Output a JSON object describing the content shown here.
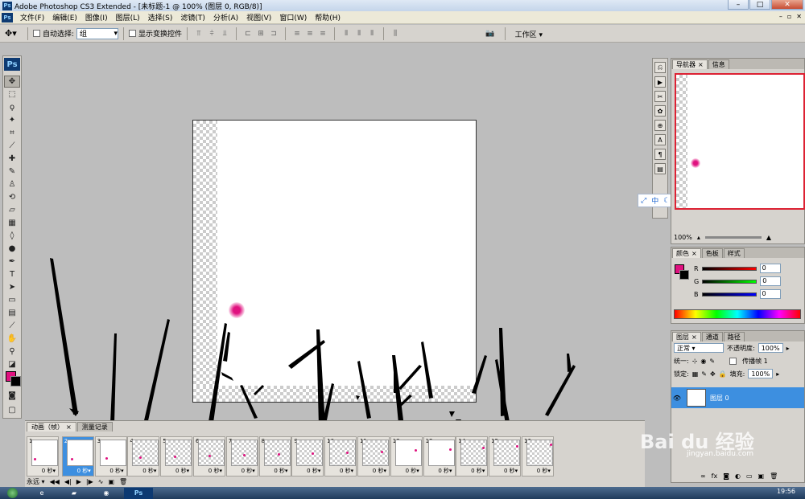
{
  "window": {
    "app_title": "Adobe Photoshop CS3 Extended - [未标题-1 @ 100% (图层 0, RGB/8)]",
    "controls": [
      "–",
      "□",
      "✕"
    ]
  },
  "menu": {
    "items": [
      "文件(F)",
      "编辑(E)",
      "图像(I)",
      "图层(L)",
      "选择(S)",
      "滤镜(T)",
      "分析(A)",
      "视图(V)",
      "窗口(W)",
      "帮助(H)"
    ]
  },
  "options": {
    "auto_select_label": "自动选择:",
    "auto_select_value": "组",
    "show_transform_label": "显示变换控件",
    "workspace_label": "工作区 ▾"
  },
  "toolbar": {
    "logo": "Ps",
    "tools": [
      "move-tool",
      "marquee-tool",
      "lasso-tool",
      "magic-wand-tool",
      "crop-tool",
      "slice-tool",
      "healing-brush-tool",
      "brush-tool",
      "clone-stamp-tool",
      "history-brush-tool",
      "eraser-tool",
      "gradient-tool",
      "blur-tool",
      "dodge-tool",
      "pen-tool",
      "type-tool",
      "path-selection-tool",
      "shape-tool",
      "notes-tool",
      "eyedropper-tool",
      "hand-tool",
      "zoom-tool"
    ],
    "colors": {
      "foreground": "#e0117f",
      "background": "#000000"
    }
  },
  "animation": {
    "tabs": [
      "动画（帧）",
      "测量记录"
    ],
    "frames": [
      {
        "num": "1",
        "duration": "0 秒▾"
      },
      {
        "num": "2",
        "duration": "0 秒▾"
      },
      {
        "num": "3",
        "duration": "0 秒▾"
      },
      {
        "num": "4",
        "duration": "0 秒▾"
      },
      {
        "num": "5",
        "duration": "0 秒▾"
      },
      {
        "num": "6",
        "duration": "0 秒▾"
      },
      {
        "num": "7",
        "duration": "0 秒▾"
      },
      {
        "num": "8",
        "duration": "0 秒▾"
      },
      {
        "num": "9",
        "duration": "0 秒▾"
      },
      {
        "num": "10",
        "duration": "0 秒▾"
      },
      {
        "num": "11",
        "duration": "0 秒▾"
      },
      {
        "num": "12",
        "duration": "0 秒▾"
      },
      {
        "num": "13",
        "duration": "0 秒▾"
      },
      {
        "num": "14",
        "duration": "0 秒▾"
      },
      {
        "num": "15",
        "duration": "0 秒▾"
      },
      {
        "num": "16",
        "duration": "0 秒▾"
      }
    ],
    "loop_label": "永远 ▾"
  },
  "navigator": {
    "tabs": [
      "导航器",
      "信息"
    ],
    "zoom": "100%"
  },
  "color_panel": {
    "tabs": [
      "颜色",
      "色板",
      "样式"
    ],
    "r_label": "R",
    "g_label": "G",
    "b_label": "B",
    "r_value": "0",
    "g_value": "0",
    "b_value": "0"
  },
  "layers_panel": {
    "tabs": [
      "图层",
      "通道",
      "路径"
    ],
    "blend_mode": "正常",
    "opacity_label": "不透明度:",
    "opacity_value": "100%",
    "unify_label": "统一:",
    "propagate_label": "传播帧 1",
    "lock_label": "锁定:",
    "fill_label": "填充:",
    "fill_value": "100%",
    "layer_name": "图层 0"
  },
  "floating_toolbar": [
    "中"
  ],
  "taskbar": {
    "ps_label": "Ps",
    "clock": "19:56"
  },
  "watermark": {
    "brand": "Bai du 经验",
    "url": "jingyan.baidu.com"
  }
}
